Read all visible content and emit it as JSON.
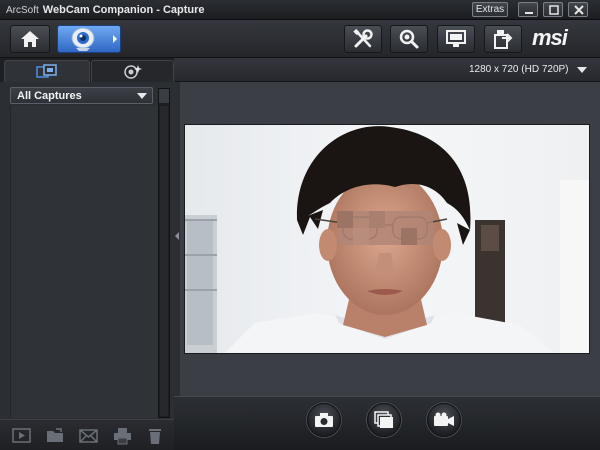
{
  "window": {
    "brand": "ArcSoft",
    "title": "WebCam Companion - Capture",
    "extras_label": "Extras",
    "logo_text": "msi"
  },
  "toolbar": {
    "buttons": [
      {
        "name": "home",
        "icon": "home-icon"
      },
      {
        "name": "capture",
        "icon": "webcam-icon",
        "active": true
      },
      {
        "name": "settings",
        "icon": "tools-icon"
      },
      {
        "name": "search",
        "icon": "magnifier-icon"
      },
      {
        "name": "display",
        "icon": "monitor-icon"
      },
      {
        "name": "export",
        "icon": "export-icon"
      }
    ]
  },
  "left_panel": {
    "tabs": [
      {
        "icon": "captures-icon",
        "active": true
      },
      {
        "icon": "effects-icon",
        "active": false
      }
    ],
    "filter": {
      "selected": "All Captures"
    },
    "bottom_actions": [
      "play-icon",
      "open-folder-icon",
      "email-icon",
      "print-icon",
      "trash-icon"
    ]
  },
  "preview": {
    "resolution": "1280 x 720 (HD 720P)"
  },
  "capture_controls": [
    "snapshot-camera-icon",
    "burst-capture-icon",
    "video-record-icon"
  ],
  "colors": {
    "accent": "#3d7ad9",
    "panel": "#2b2e33",
    "background": "#1e2024"
  }
}
